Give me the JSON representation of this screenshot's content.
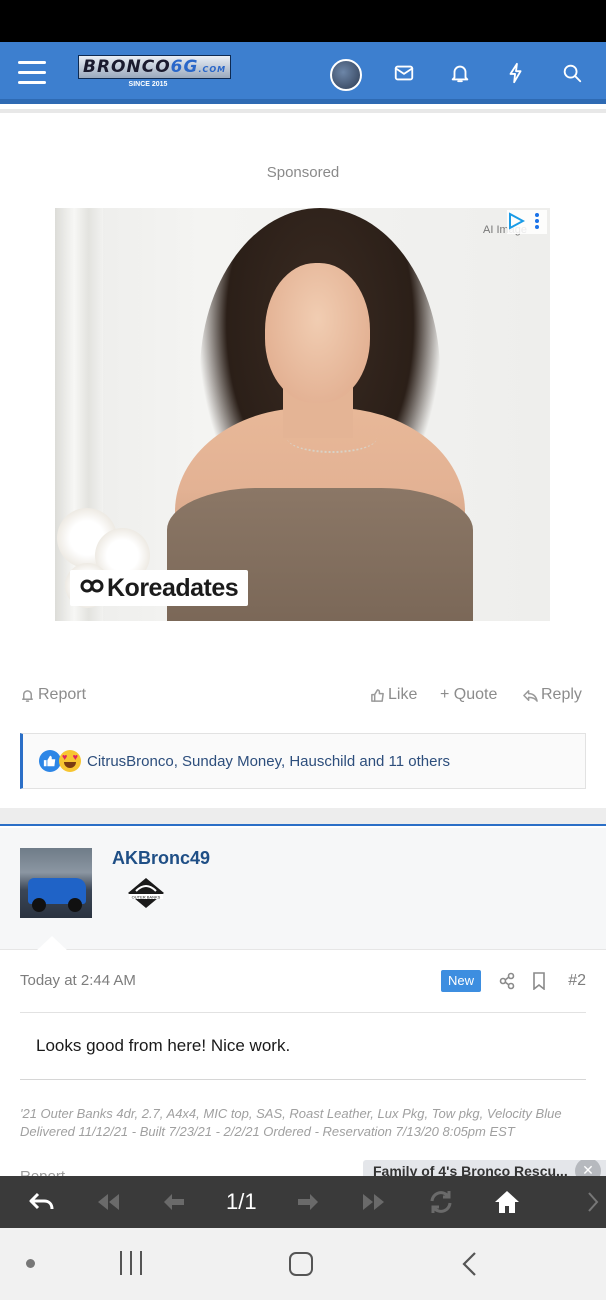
{
  "header": {
    "logo_main": "BRONCO",
    "logo_accent": "6G",
    "logo_domain": ".COM",
    "logo_since": "SINCE 2015",
    "icons": [
      "menu-icon",
      "avatar",
      "mail-icon",
      "bell-icon",
      "bolt-icon",
      "search-icon"
    ]
  },
  "ad": {
    "sponsored_label": "Sponsored",
    "ai_label": "AI Image",
    "brand": "Koreadates"
  },
  "post1": {
    "actions": {
      "report": "Report",
      "like": "Like",
      "quote": "+ Quote",
      "reply": "Reply"
    },
    "reactions_text": "CitrusBronco, Sunday Money, Hauschild and 11 others"
  },
  "post2": {
    "username": "AKBronc49",
    "badge_label": "OUTER BANKS",
    "date": "Today at 2:44 AM",
    "new_badge": "New",
    "post_number": "#2",
    "body": "Looks good from here! Nice work.",
    "signature_line1": "'21 Outer Banks 4dr, 2.7, A4x4, MIC top, SAS, Roast Leather, Lux Pkg, Tow pkg, Velocity Blue",
    "signature_line2": "Delivered 11/12/21 - Built 7/23/21 - 2/2/21 Ordered - Reservation 7/13/20 8:05pm EST",
    "peek_report": "Report"
  },
  "notification": {
    "text": "Family of 4's Bronco Rescu...",
    "close": "✕"
  },
  "toolbar": {
    "page_indicator": "1/1"
  },
  "colors": {
    "header_blue": "#3d7fcf",
    "accent_blue": "#2b6fc7",
    "new_badge": "#3d8ee0",
    "username": "#1f4f86",
    "toolbar_bg": "#3a3a3a"
  }
}
